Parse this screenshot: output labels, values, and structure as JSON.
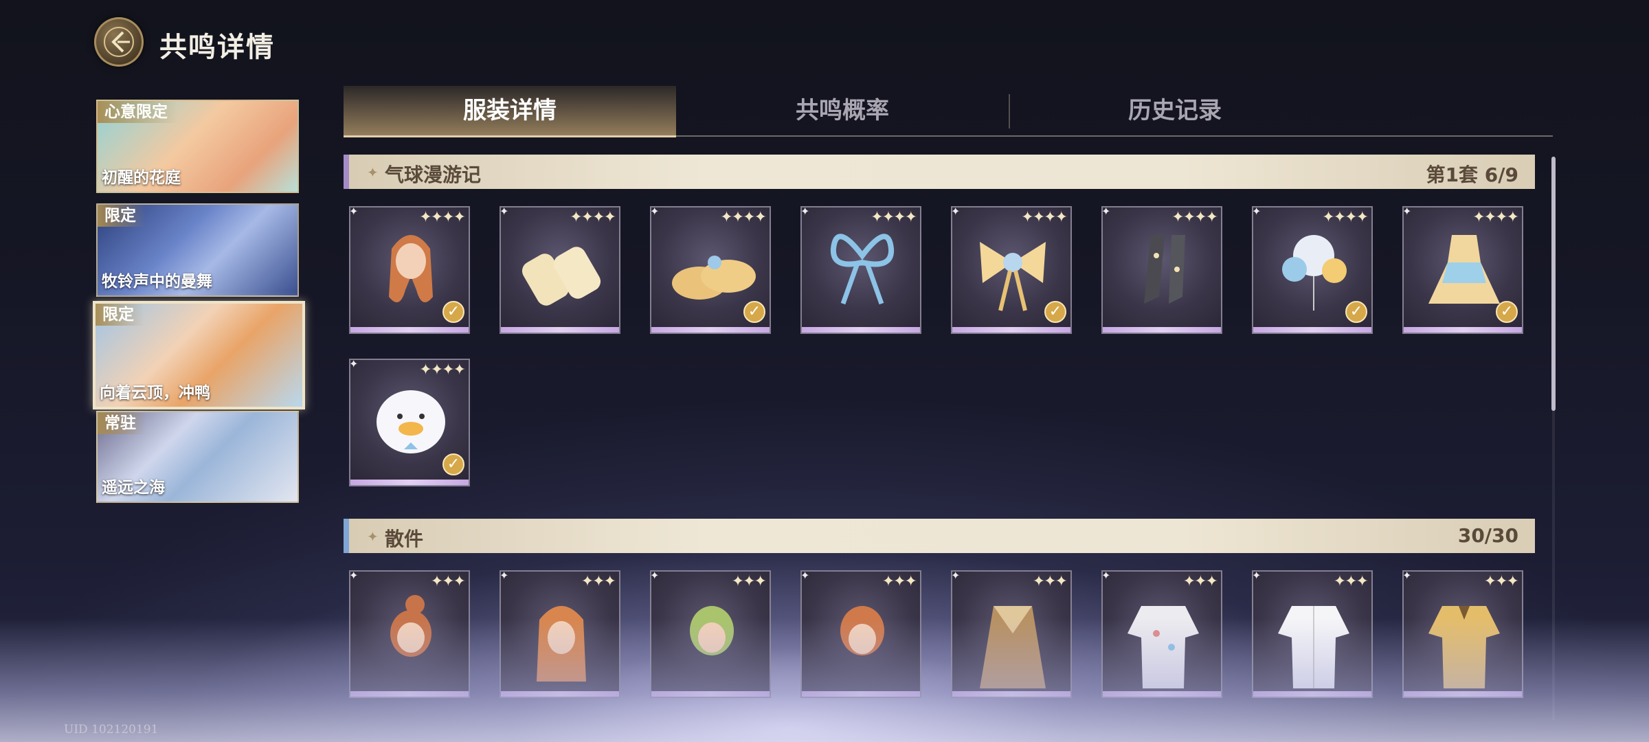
{
  "header": {
    "title": "共鸣详情"
  },
  "banners": [
    {
      "tag": "心意限定",
      "name": "初醒的花庭"
    },
    {
      "tag": "限定",
      "name": "牧铃声中的曼舞"
    },
    {
      "tag": "限定",
      "name": "向着云顶，冲鸭"
    },
    {
      "tag": "常驻",
      "name": "遥远之海"
    }
  ],
  "tabs": [
    {
      "label": "服装详情"
    },
    {
      "label": "共鸣概率"
    },
    {
      "label": "历史记录"
    }
  ],
  "sections": [
    {
      "title": "气球漫游记",
      "count": "第1套 6/9",
      "items": [
        {
          "icon": "hair-icon",
          "stars": "✦✦✦✦",
          "owned": true
        },
        {
          "icon": "gloves-icon",
          "stars": "✦✦✦✦",
          "owned": false
        },
        {
          "icon": "shoes-icon",
          "stars": "✦✦✦✦",
          "owned": true
        },
        {
          "icon": "hair-ribbon-icon",
          "stars": "✦✦✦✦",
          "owned": false
        },
        {
          "icon": "bow-accessory-icon",
          "stars": "✦✦✦✦",
          "owned": true
        },
        {
          "icon": "stockings-icon",
          "stars": "✦✦✦✦",
          "owned": false
        },
        {
          "icon": "balloons-icon",
          "stars": "✦✦✦✦",
          "owned": true
        },
        {
          "icon": "dress-icon",
          "stars": "✦✦✦✦",
          "owned": true
        },
        {
          "icon": "duck-backpack-icon",
          "stars": "✦✦✦✦",
          "owned": true
        }
      ]
    },
    {
      "title": "散件",
      "count": "30/30",
      "items": [
        {
          "icon": "hair-bun-icon",
          "stars": "✦✦✦"
        },
        {
          "icon": "hair-long-icon",
          "stars": "✦✦✦"
        },
        {
          "icon": "hair-green-icon",
          "stars": "✦✦✦"
        },
        {
          "icon": "hair-short-icon",
          "stars": "✦✦✦"
        },
        {
          "icon": "coat-icon",
          "stars": "✦✦✦"
        },
        {
          "icon": "shirt-floral-icon",
          "stars": "✦✦✦"
        },
        {
          "icon": "shirt-white-icon",
          "stars": "✦✦✦"
        },
        {
          "icon": "jacket-gold-icon",
          "stars": "✦✦✦"
        }
      ]
    }
  ],
  "footer": {
    "uid": "UID 102120191"
  },
  "colors": {
    "accent_gold": "#d6a849",
    "section_bar": "#a58cc8",
    "card_strip": "#c7a8e3"
  }
}
